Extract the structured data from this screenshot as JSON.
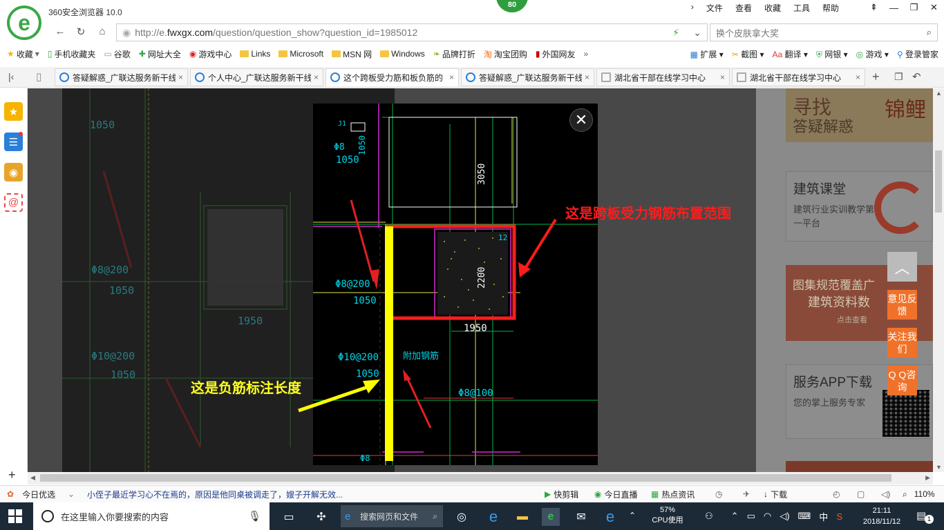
{
  "browser": {
    "app_title": "360安全浏览器 10.0",
    "badge": "80",
    "menu": [
      "文件",
      "查看",
      "收藏",
      "工具",
      "帮助"
    ],
    "url_prefix": "http://e.",
    "url_domain": "fwxgx.com",
    "url_path": "/question/question_show?question_id=1985012",
    "search_placeholder": "换个皮肤拿大奖"
  },
  "favorites": {
    "items": [
      "收藏",
      "手机收藏夹",
      "谷歌",
      "网址大全",
      "游戏中心",
      "Links",
      "Microsoft",
      "MSN 网",
      "Windows",
      "品牌打折",
      "淘宝团购",
      "外国网友"
    ],
    "right": [
      "扩展",
      "截图",
      "翻译",
      "网银",
      "游戏",
      "登录管家"
    ]
  },
  "tabs": [
    {
      "label": "答疑解惑_广联达服务新干线",
      "active": false
    },
    {
      "label": "个人中心_广联达服务新干线",
      "active": false
    },
    {
      "label": "这个跨板受力筋和板负筋的",
      "active": true
    },
    {
      "label": "答疑解惑_广联达服务新干线",
      "active": false
    },
    {
      "label": "湖北省干部在线学习中心",
      "active": false
    },
    {
      "label": "湖北省干部在线学习中心",
      "active": false
    }
  ],
  "right_pane": {
    "banner1_text": "寻找",
    "banner1_sub": "答疑解惑",
    "banner1_side": "锦鲤",
    "course_title": "建筑课堂",
    "course_desc": "建筑行业实训教学第一平台",
    "banner2_line1": "图集规范覆盖广",
    "banner2_line2": "建筑资料数",
    "banner2_line3": "点击查看",
    "app_title": "服务APP下载",
    "app_desc": "您的掌上服务专家"
  },
  "float_buttons": {
    "feedback": "意见反馈",
    "follow": "关注我们",
    "qq": "Q Q咨询"
  },
  "drawing": {
    "annotation_red": "这是跨板受力钢筋布置范围",
    "annotation_yellow": "这是负筋标注长度",
    "labels": {
      "spec_8_200": "Φ8@200",
      "spec_10_200": "Φ10@200",
      "spec_8_100": "Φ8@100",
      "spec_8": "Φ8",
      "len_1050": "1050",
      "len_1950": "1950",
      "len_2200": "2200",
      "len_3050": "3050",
      "extra_rebar": "附加钢筋",
      "tag_12": "12",
      "tag_j1": "J1"
    }
  },
  "statusbar": {
    "news_label": "今日优选",
    "news_text": "小侄子最近学习心不在焉的，原因是他同桌被调走了，嫂子开解无效...",
    "items": [
      "快剪辑",
      "今日直播",
      "热点资讯",
      "下载"
    ],
    "zoom": "110%"
  },
  "taskbar": {
    "search_placeholder": "在这里输入你要搜索的内容",
    "web_search": "搜索网页和文件",
    "cpu_percent": "57%",
    "cpu_label": "CPU使用",
    "ime": "中",
    "time": "21:11",
    "date": "2018/11/12",
    "notification_count": "1"
  }
}
